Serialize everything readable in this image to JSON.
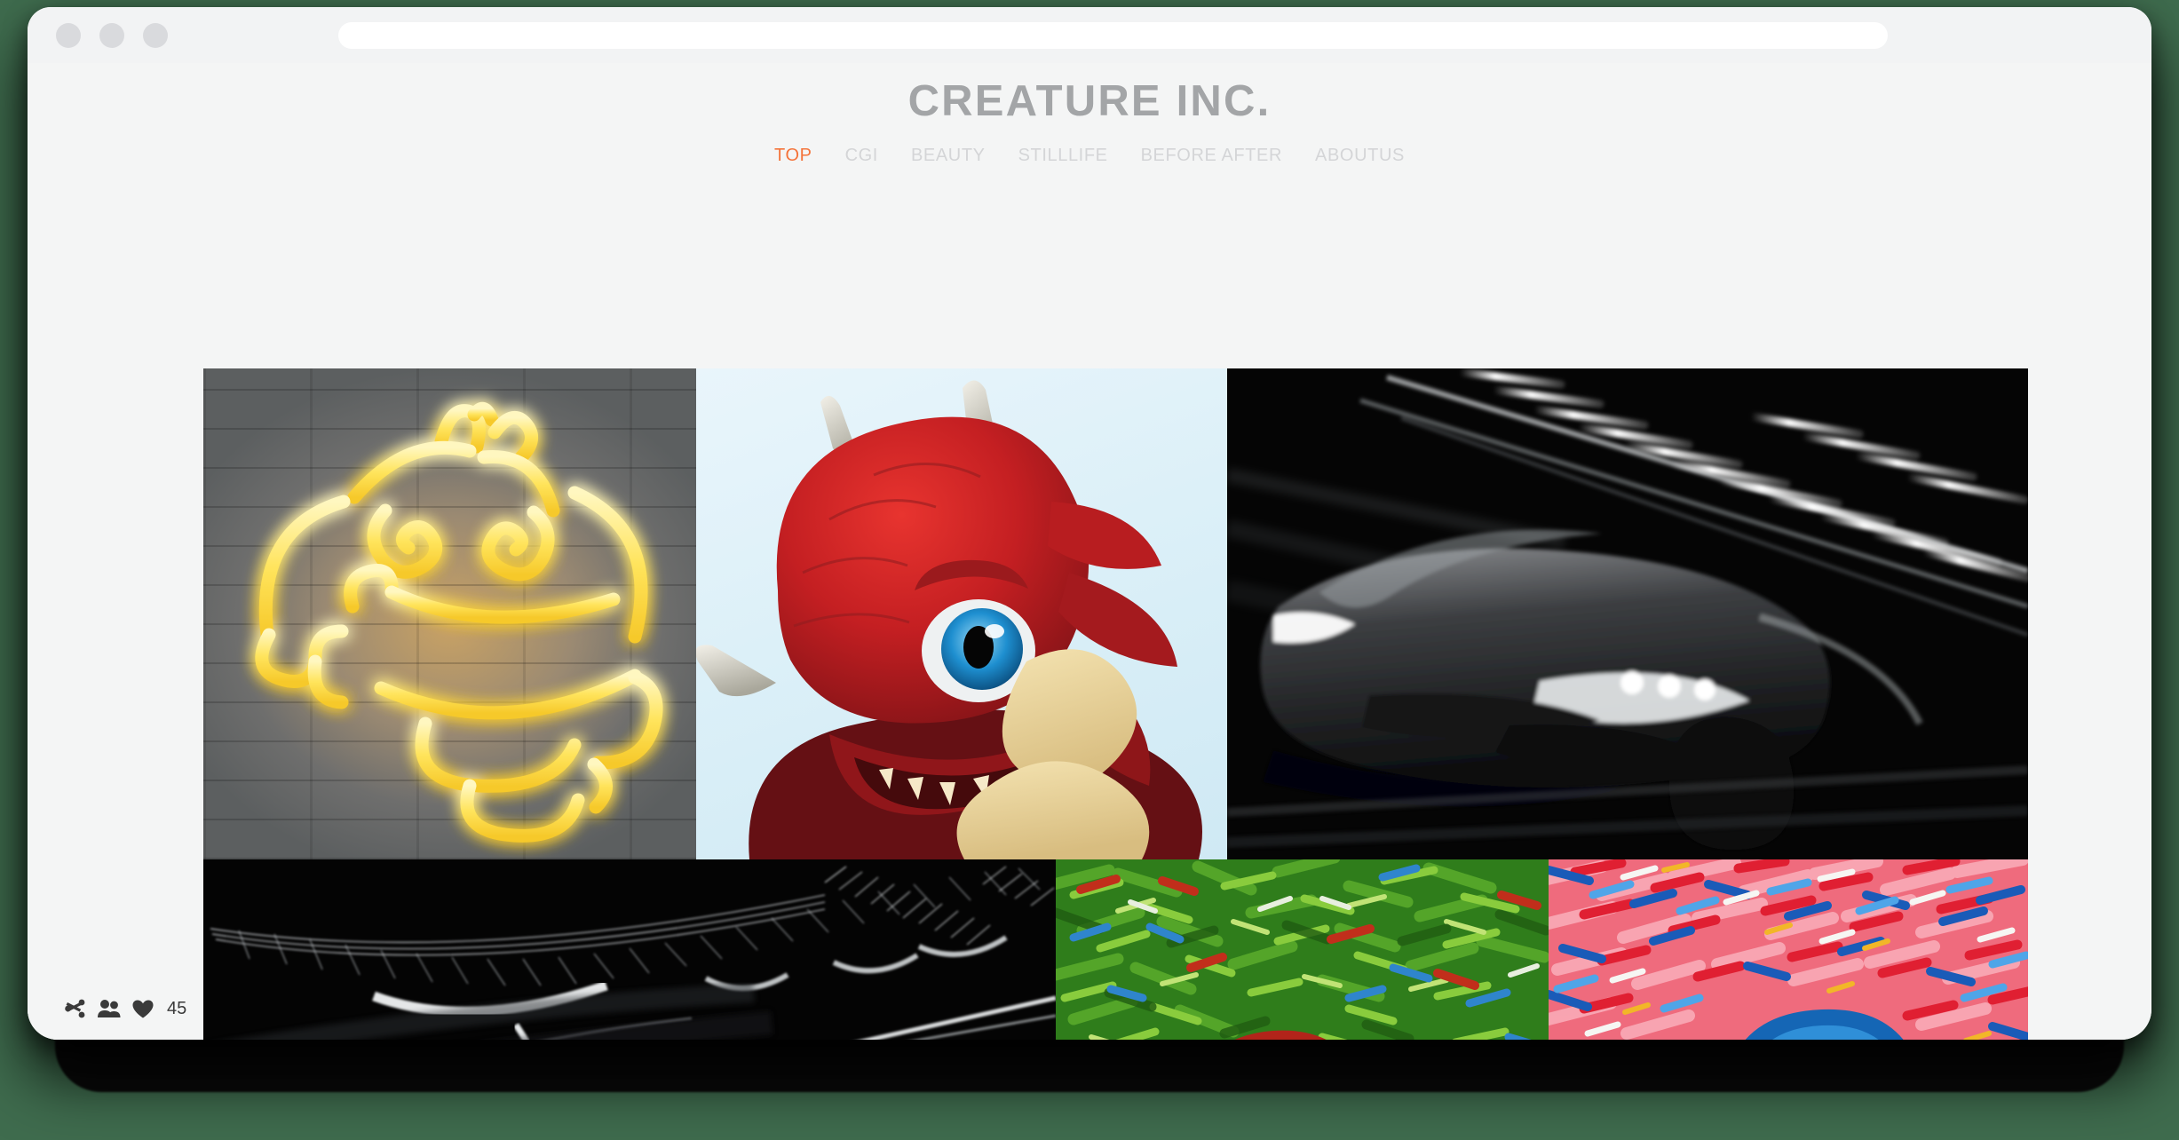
{
  "browser": {
    "traffic_lights": [
      "close",
      "minimize",
      "maximize"
    ],
    "address_bar_value": "",
    "address_bar_placeholder": ""
  },
  "site": {
    "title": "CREATURE INC."
  },
  "nav": {
    "items": [
      {
        "label": "TOP",
        "active": true
      },
      {
        "label": "CGI",
        "active": false
      },
      {
        "label": "BEAUTY",
        "active": false
      },
      {
        "label": "STILLLIFE",
        "active": false
      },
      {
        "label": "BEFORE AFTER",
        "active": false
      },
      {
        "label": "ABOUTUS",
        "active": false
      }
    ],
    "active_color": "#f4743b",
    "inactive_color": "#d4d5d7"
  },
  "gallery": {
    "rows": [
      {
        "tiles": [
          {
            "name": "neon-creature-sign",
            "alt": "Yellow neon creature sign on grey brick wall"
          },
          {
            "name": "red-dragon-hatchling",
            "alt": "Red CGI dragon hatchling with blue eye in eggshell"
          },
          {
            "name": "night-sports-car",
            "alt": "Black and white motion blurred sports car at night"
          }
        ]
      },
      {
        "tiles": [
          {
            "name": "light-streaks",
            "alt": "Black and white long exposure light streaks"
          },
          {
            "name": "green-impasto-painting",
            "alt": "Green impasto oil painting with red haired figure"
          },
          {
            "name": "red-blue-impasto-painting",
            "alt": "Red and blue impasto oil painting with blue swirl"
          }
        ]
      }
    ]
  },
  "footer": {
    "share_label": "share",
    "followers_label": "followers",
    "like_label": "like",
    "like_count": "45"
  },
  "colors": {
    "page_background": "#3f6c4e",
    "window_background": "#f4f5f5",
    "title_grey": "#a3a5a7",
    "accent_orange": "#f4743b"
  }
}
